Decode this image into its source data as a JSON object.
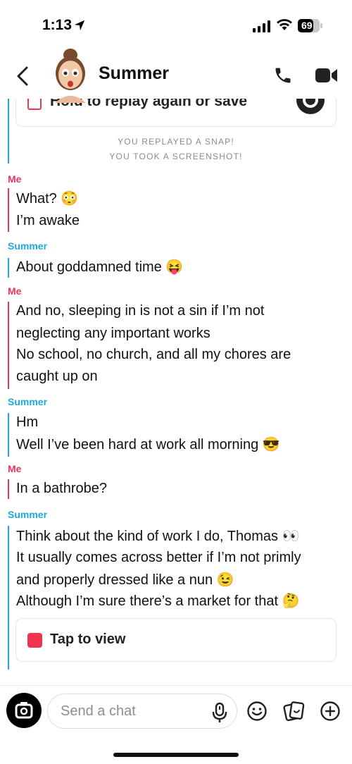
{
  "status_bar": {
    "time": "1:13",
    "battery": "69"
  },
  "header": {
    "contact_name": "Summer"
  },
  "snap_card": {
    "text": "Hold to replay again or save"
  },
  "system_messages": [
    "YOU REPLAYED A SNAP!",
    "YOU TOOK A SCREENSHOT!"
  ],
  "messages": [
    {
      "sender": "Me",
      "lines": [
        "What? 😳",
        "I’m awake"
      ]
    },
    {
      "sender": "Summer",
      "lines": [
        "About goddamned time 😝"
      ]
    },
    {
      "sender": "Me",
      "lines": [
        "And no, sleeping in is not a sin if I’m not",
        "neglecting any important works",
        "No school, no church, and all my chores are",
        "caught up on"
      ]
    },
    {
      "sender": "Summer",
      "lines": [
        "Hm",
        "Well I’ve been hard at work all morning 😎"
      ]
    },
    {
      "sender": "Me",
      "lines": [
        "In a bathrobe?"
      ]
    },
    {
      "sender": "Summer",
      "lines": [
        "Think about the kind of work I do, Thomas 👀",
        "It usually comes across better if I’m not primly",
        "and properly dressed like a nun 😉",
        "Although I’m sure there’s a market for that 🤔"
      ]
    }
  ],
  "tap_card": {
    "text": "Tap to view"
  },
  "composer": {
    "placeholder": "Send a chat"
  },
  "colors": {
    "me": "#e8355a",
    "them": "#1ba9e1",
    "snap_red": "#f2334f"
  }
}
